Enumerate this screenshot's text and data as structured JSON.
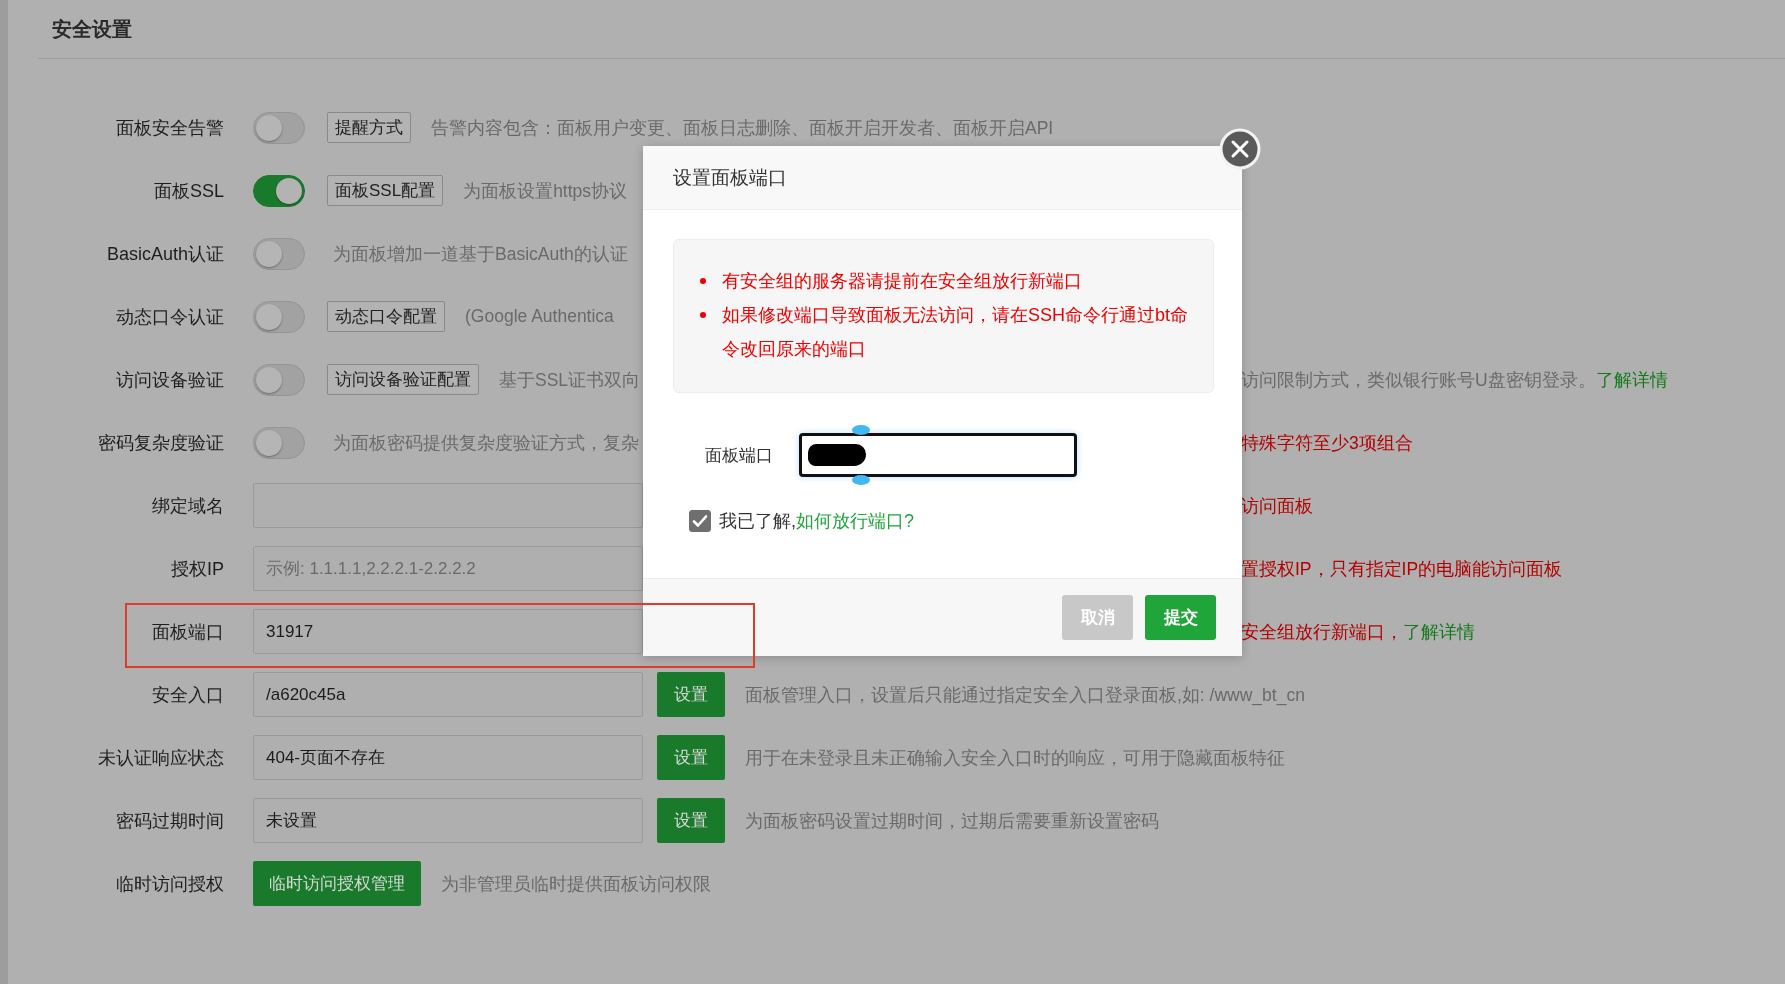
{
  "page_title": "安全设置",
  "settings": [
    {
      "kind": "toggle",
      "label": "面板安全告警",
      "on": false,
      "button": "提醒方式",
      "description": "告警内容包含：面板用户变更、面板日志删除、面板开启开发者、面板开启API"
    },
    {
      "kind": "toggle",
      "label": "面板SSL",
      "on": true,
      "button": "面板SSL配置",
      "description": "为面板设置https协议"
    },
    {
      "kind": "toggle",
      "label": "BasicAuth认证",
      "on": false,
      "description": "为面板增加一道基于BasicAuth的认证"
    },
    {
      "kind": "toggle",
      "label": "动态口令认证",
      "on": false,
      "button": "动态口令配置",
      "description": "(Google Authentica"
    },
    {
      "kind": "toggle",
      "label": "访问设备验证",
      "on": false,
      "button": "访问设备验证配置",
      "description": "基于SSL证书双向",
      "note": "访问限制方式，类似银行账号U盘密钥登录。",
      "note_warning": false,
      "link": "了解详情"
    },
    {
      "kind": "toggle",
      "label": "密码复杂度验证",
      "on": false,
      "description": "为面板密码提供复杂度验证方式，复杂",
      "note": "特殊字符至少3项组合",
      "note_warning": true
    },
    {
      "kind": "input",
      "label": "绑定域名",
      "note": "访问面板",
      "note_warning": true
    },
    {
      "kind": "input",
      "label": "授权IP",
      "placeholder": "示例: 1.1.1.1,2.2.2.1-2.2.2.2",
      "note": "置授权IP，只有指定IP的电脑能访问面板",
      "note_warning": true
    },
    {
      "kind": "input",
      "label": "面板端口",
      "value": "31917",
      "highlighted": true,
      "note": "安全组放行新端口，",
      "note_warning": true,
      "link": "了解详情"
    },
    {
      "kind": "input",
      "label": "安全入口",
      "value": "/a620c45a",
      "button": "设置",
      "description": "面板管理入口，设置后只能通过指定安全入口登录面板,如: /www_bt_cn"
    },
    {
      "kind": "input",
      "label": "未认证响应状态",
      "value": "404-页面不存在",
      "button": "设置",
      "description": "用于在未登录且未正确输入安全入口时的响应，可用于隐藏面板特征"
    },
    {
      "kind": "input",
      "label": "密码过期时间",
      "value": "未设置",
      "button": "设置",
      "description": "为面板密码设置过期时间，过期后需要重新设置密码"
    },
    {
      "kind": "action",
      "label": "临时访问授权",
      "button": "临时访问授权管理",
      "description": "为非管理员临时提供面板访问权限"
    }
  ],
  "dialog": {
    "title": "设置面板端口",
    "notices": [
      "有安全组的服务器请提前在安全组放行新端口",
      "如果修改端口导致面板无法访问，请在SSH命令行通过bt命令改回原来的端口"
    ],
    "field": {
      "label": "面板端口",
      "redacted": true
    },
    "acknowledge": {
      "checked": true,
      "text": "我已了解,",
      "link": "如何放行端口?"
    },
    "buttons": [
      {
        "label": "取消",
        "kind": "secondary"
      },
      {
        "label": "提交",
        "kind": "primary"
      }
    ]
  }
}
